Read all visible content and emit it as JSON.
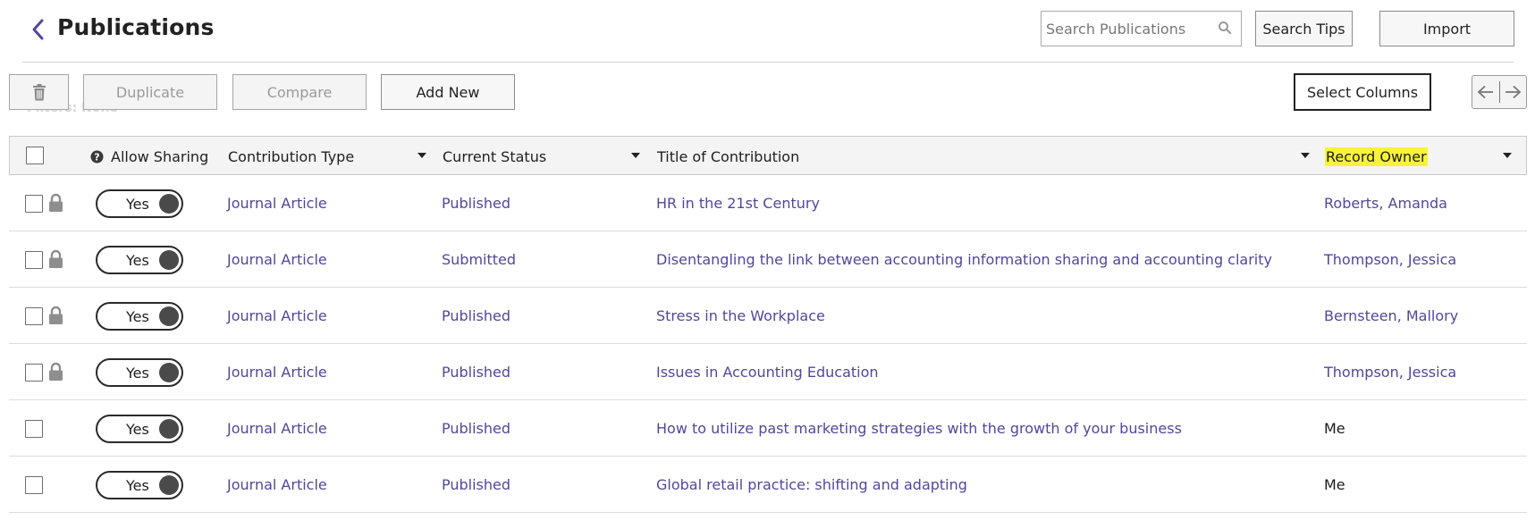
{
  "header": {
    "title": "Publications",
    "search_placeholder": "Search Publications",
    "search_value": "",
    "search_tips_label": "Search Tips",
    "import_label": "Import"
  },
  "toolbar": {
    "duplicate_label": "Duplicate",
    "compare_label": "Compare",
    "add_new_label": "Add New",
    "select_columns_label": "Select Columns",
    "filters_text": "Filters: None"
  },
  "table": {
    "columns": {
      "allow_sharing": "Allow Sharing",
      "contribution_type": "Contribution Type",
      "current_status": "Current Status",
      "title": "Title of Contribution",
      "record_owner": "Record Owner"
    },
    "rows": [
      {
        "sharing": "Yes",
        "type": "Journal Article",
        "status": "Published",
        "title": "HR in the 21st Century",
        "owner": "Roberts, Amanda",
        "locked": true
      },
      {
        "sharing": "Yes",
        "type": "Journal Article",
        "status": "Submitted",
        "title": "Disentangling the link between accounting information sharing and accounting clarity",
        "owner": "Thompson, Jessica",
        "locked": true
      },
      {
        "sharing": "Yes",
        "type": "Journal Article",
        "status": "Published",
        "title": "Stress in the Workplace",
        "owner": "Bernsteen, Mallory",
        "locked": true
      },
      {
        "sharing": "Yes",
        "type": "Journal Article",
        "status": "Published",
        "title": "Issues in Accounting Education",
        "owner": "Thompson, Jessica",
        "locked": true
      },
      {
        "sharing": "Yes",
        "type": "Journal Article",
        "status": "Published",
        "title": "How to utilize past marketing strategies with the growth of your business",
        "owner": "Me",
        "locked": false
      },
      {
        "sharing": "Yes",
        "type": "Journal Article",
        "status": "Published",
        "title": "Global retail practice: shifting and adapting",
        "owner": "Me",
        "locked": false
      }
    ]
  },
  "colors": {
    "link": "#4f489a",
    "highlight": "#f8f33a",
    "header_bg": "#f4f4f4"
  },
  "icons": [
    "chevron-left-icon",
    "search-icon",
    "trash-icon",
    "arrow-left-icon",
    "arrow-right-icon",
    "help-icon",
    "lock-icon"
  ]
}
